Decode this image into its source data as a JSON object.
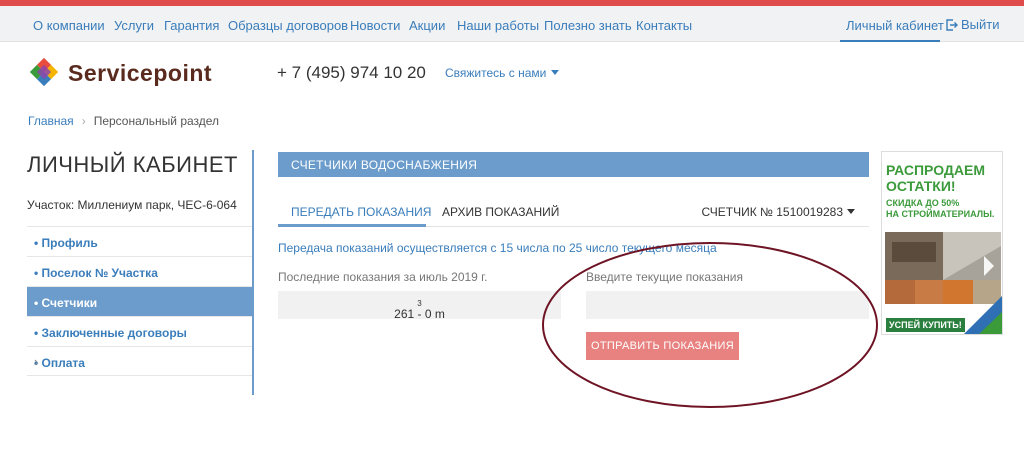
{
  "colors": {
    "accent": "#3a7dbb",
    "topbar": "#e04b4b",
    "panel": "#6b9ccc",
    "button": "#e88280",
    "annotation": "#6e1424"
  },
  "nav": {
    "items": [
      "О компании",
      "Услуги",
      "Гарантия",
      "Образцы договоров",
      "Новости",
      "Акции",
      "Наши работы",
      "Полезно знать",
      "Контакты"
    ],
    "cabinet": "Личный кабинет",
    "logout": "Выйти"
  },
  "header": {
    "brand": "Servicepoint",
    "phone": "+ 7 (495) 974 10 20",
    "contact": "Свяжитесь с нами"
  },
  "breadcrumb": {
    "home": "Главная",
    "current": "Персональный раздел"
  },
  "sidebar": {
    "title": "ЛИЧНЫЙ КАБИНЕТ",
    "plot": "Участок: Миллениум парк, ЧЕС-6-064",
    "items": [
      {
        "label": "• Профиль"
      },
      {
        "label": "• Поселок № Участка"
      },
      {
        "label": "• Счетчики"
      },
      {
        "label": "• Заключенные договоры"
      },
      {
        "label": "• Оплата"
      }
    ]
  },
  "panel": {
    "title": "СЧЕТЧИКИ ВОДОСНАБЖЕНИЯ",
    "tabs": [
      "ПЕРЕДАТЬ ПОКАЗАНИЯ",
      "АРХИВ ПОКАЗАНИЙ"
    ],
    "meter": "СЧЕТЧИК № 1510019283",
    "info": "Передача показаний осуществляется с 15 числа по 25 число текущего месяца",
    "last_label": "Последние показания за июль 2019 г.",
    "last_value": "261 - 0 m",
    "last_unit_sup": "3",
    "current_label": "Введите текущие показания",
    "current_value": "",
    "submit": "ОТПРАВИТЬ ПОКАЗАНИЯ"
  },
  "banner": {
    "line1": "РАСПРОДАЕМ",
    "line2": "ОСТАТКИ!",
    "line3": "СКИДКА ДО 50%",
    "line4": "НА СТРОЙМАТЕРИАЛЫ.",
    "cta": "УСПЕЙ КУПИТЬ!"
  }
}
